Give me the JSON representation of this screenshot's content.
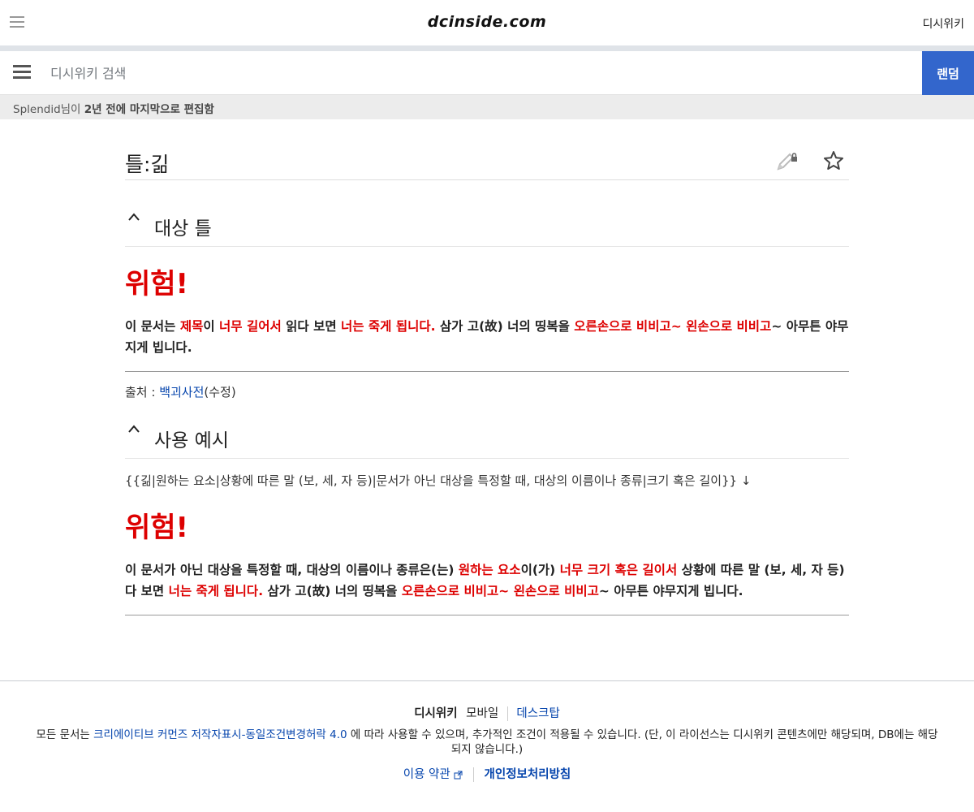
{
  "header": {
    "logo": "dcinside.com",
    "right_link": "디시위키"
  },
  "search": {
    "placeholder": "디시위키 검색",
    "random_label": "랜덤"
  },
  "last_edit": {
    "user": "Splendid",
    "suffix_plain": "님이 ",
    "suffix_bold": "2년 전에 마지막으로 편집함"
  },
  "page": {
    "title": "틀:긺"
  },
  "sections": [
    {
      "title": "대상 틀",
      "danger_title": "위험!",
      "text_parts": [
        {
          "t": "이 문서는 ",
          "red": false
        },
        {
          "t": "제목",
          "red": true
        },
        {
          "t": "이 ",
          "red": false
        },
        {
          "t": "너무 길어서",
          "red": true
        },
        {
          "t": " 읽다 보면 ",
          "red": false
        },
        {
          "t": "너는 죽게 됩니다.",
          "red": true
        },
        {
          "t": " 삼가 고(故) 너의 띵복을 ",
          "red": false
        },
        {
          "t": "오른손으로 비비고~ 왼손으로 비비고",
          "red": true
        },
        {
          "t": "~ 아무튼 야무지게 빕니다.",
          "red": false
        }
      ],
      "source_label": "출처 : ",
      "source_link": "백괴사전",
      "source_suffix": "(수정)"
    },
    {
      "title": "사용 예시",
      "usage_line": "{{긺|원하는 요소|상황에 따른 말 (보, 세, 자 등)|문서가 아닌 대상을 특정할 때, 대상의 이름이나 종류|크기 혹은 길이}} ↓",
      "danger_title": "위험!",
      "text_parts": [
        {
          "t": "이 문서가 아닌 대상을 특정할 때, 대상의 이름이나 종류은(는) ",
          "red": false
        },
        {
          "t": "원하는 요소",
          "red": true
        },
        {
          "t": "이(가) ",
          "red": false
        },
        {
          "t": "너무 크기 혹은 길이서",
          "red": true
        },
        {
          "t": " 상황에 따른 말 (보, 세, 자 등)다 보면 ",
          "red": false
        },
        {
          "t": "너는 죽게 됩니다.",
          "red": true
        },
        {
          "t": " 삼가 고(故) 너의 띵복을 ",
          "red": false
        },
        {
          "t": "오른손으로 비비고~ 왼손으로 비비고",
          "red": true
        },
        {
          "t": "~ 아무튼 야무지게 빕니다.",
          "red": false
        }
      ]
    }
  ],
  "footer": {
    "brand": "디시위키",
    "mobile": "모바일",
    "desktop": "데스크탑",
    "license_prefix": "모든 문서는 ",
    "license_link": "크리에이티브 커먼즈 저작자표시-동일조건변경허락 4.0",
    "license_suffix": " 에 따라 사용할 수 있으며, 추가적인 조건이 적용될 수 있습니다. (단, 이 라이선스는 디시위키 콘텐츠에만 해당되며, DB에는 해당 되지 않습니다.)",
    "terms": "이용 약관",
    "privacy": "개인정보처리방침"
  }
}
